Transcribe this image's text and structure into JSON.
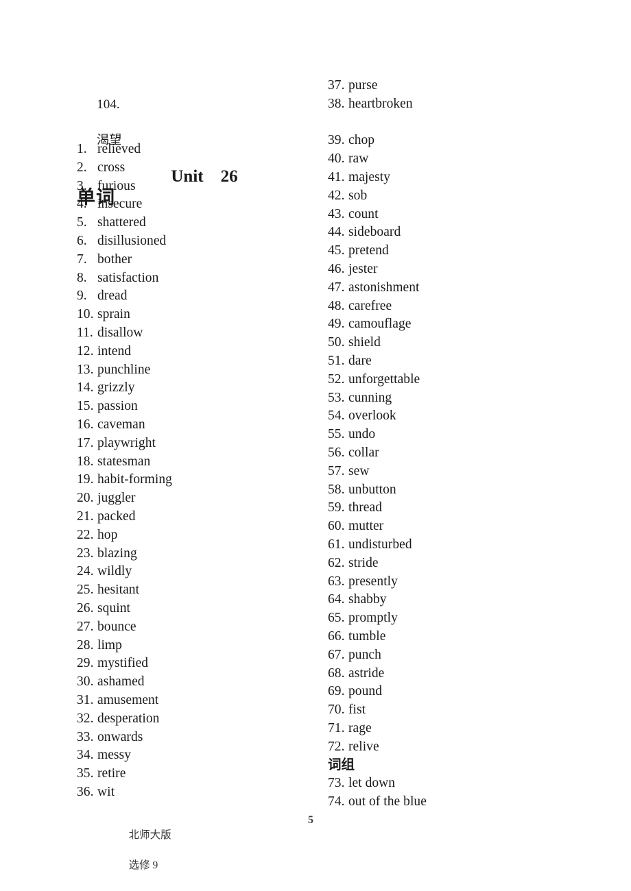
{
  "page": {
    "entry_number": "104.",
    "entry_term_cjk": "渴望",
    "unit_title": "Unit　26",
    "words_heading": "单词",
    "phrases_heading": "词组"
  },
  "footer": {
    "imprint_cjk": "北师大版",
    "volume_label": "选修 9",
    "page_number": "5"
  },
  "left_column": [
    {
      "index": "1.",
      "term": "relieved"
    },
    {
      "index": "2.",
      "term": "cross"
    },
    {
      "index": "3.",
      "term": "furious"
    },
    {
      "index": "4.",
      "term": "insecure"
    },
    {
      "index": "5.",
      "term": "shattered"
    },
    {
      "index": "6.",
      "term": "disillusioned"
    },
    {
      "index": "7.",
      "term": "bother"
    },
    {
      "index": "8.",
      "term": "satisfaction"
    },
    {
      "index": "9.",
      "term": "dread"
    },
    {
      "index": "10.",
      "term": "sprain"
    },
    {
      "index": "11.",
      "term": "disallow"
    },
    {
      "index": "12.",
      "term": "intend"
    },
    {
      "index": "13.",
      "term": "punchline"
    },
    {
      "index": "14.",
      "term": "grizzly"
    },
    {
      "index": "15.",
      "term": "passion"
    },
    {
      "index": "16.",
      "term": "caveman"
    },
    {
      "index": "17.",
      "term": "playwright"
    },
    {
      "index": "18.",
      "term": "statesman"
    },
    {
      "index": "19.",
      "term": "habit-forming"
    },
    {
      "index": "20.",
      "term": "juggler"
    },
    {
      "index": "21.",
      "term": "packed"
    },
    {
      "index": "22.",
      "term": "hop"
    },
    {
      "index": "23.",
      "term": "blazing"
    },
    {
      "index": "24.",
      "term": "wildly"
    },
    {
      "index": "25.",
      "term": "hesitant"
    },
    {
      "index": "26.",
      "term": "squint"
    },
    {
      "index": "27.",
      "term": "bounce"
    },
    {
      "index": "28.",
      "term": "limp"
    },
    {
      "index": "29.",
      "term": "mystified"
    },
    {
      "index": "30.",
      "term": "ashamed"
    },
    {
      "index": "31.",
      "term": "amusement"
    },
    {
      "index": "32.",
      "term": "desperation"
    },
    {
      "index": "33.",
      "term": "onwards"
    },
    {
      "index": "34.",
      "term": "messy"
    },
    {
      "index": "35.",
      "term": "retire"
    },
    {
      "index": "36.",
      "term": "wit"
    }
  ],
  "right_column": [
    {
      "index": "37.",
      "term": "purse"
    },
    {
      "index": "38.",
      "term": "heartbroken"
    },
    {
      "index": "",
      "term": ""
    },
    {
      "index": "39.",
      "term": "chop"
    },
    {
      "index": "40.",
      "term": "raw"
    },
    {
      "index": "41.",
      "term": "majesty"
    },
    {
      "index": "42.",
      "term": "sob"
    },
    {
      "index": "43.",
      "term": "count"
    },
    {
      "index": "44.",
      "term": "sideboard"
    },
    {
      "index": "45.",
      "term": "pretend"
    },
    {
      "index": "46.",
      "term": "jester"
    },
    {
      "index": "47.",
      "term": "astonishment"
    },
    {
      "index": "48.",
      "term": "carefree"
    },
    {
      "index": "49.",
      "term": "camouflage"
    },
    {
      "index": "50.",
      "term": "shield"
    },
    {
      "index": "51.",
      "term": "dare"
    },
    {
      "index": "52.",
      "term": "unforgettable"
    },
    {
      "index": "53.",
      "term": "cunning"
    },
    {
      "index": "54.",
      "term": "overlook"
    },
    {
      "index": "55.",
      "term": "undo"
    },
    {
      "index": "56.",
      "term": "collar"
    },
    {
      "index": "57.",
      "term": "sew"
    },
    {
      "index": "58.",
      "term": "unbutton"
    },
    {
      "index": "59.",
      "term": "thread"
    },
    {
      "index": "60.",
      "term": "mutter"
    },
    {
      "index": "61.",
      "term": "undisturbed"
    },
    {
      "index": "62.",
      "term": "stride"
    },
    {
      "index": "63.",
      "term": "presently"
    },
    {
      "index": "64.",
      "term": "shabby"
    },
    {
      "index": "65.",
      "term": "promptly"
    },
    {
      "index": "66.",
      "term": "tumble"
    },
    {
      "index": "67.",
      "term": "punch"
    },
    {
      "index": "68.",
      "term": "astride"
    },
    {
      "index": "69.",
      "term": "pound"
    },
    {
      "index": "70.",
      "term": "fist"
    },
    {
      "index": "71.",
      "term": "rage"
    },
    {
      "index": "72.",
      "term": "relive"
    }
  ],
  "right_column_after_phrases_heading": [
    {
      "index": "73.",
      "term": "let down"
    },
    {
      "index": "74.",
      "term": "out of the blue"
    }
  ]
}
